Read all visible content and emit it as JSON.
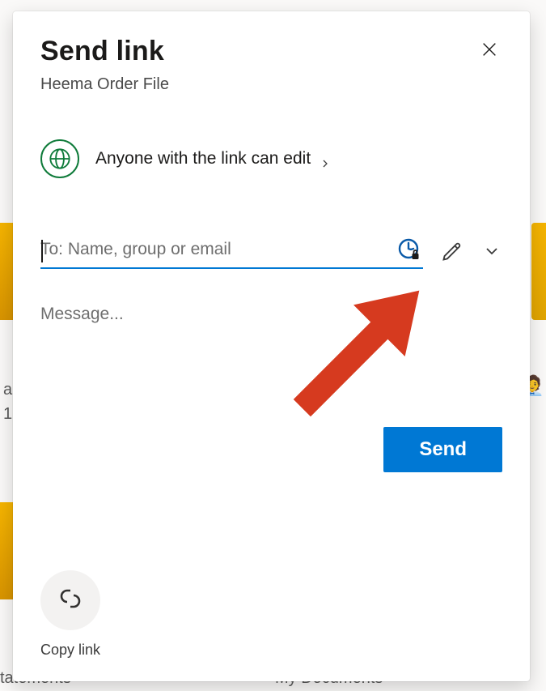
{
  "dialog": {
    "title": "Send link",
    "subtitle": "Heema Order File",
    "permission_text": "Anyone with the link can edit",
    "recipient_placeholder": "To: Name, group or email",
    "message_placeholder": "Message...",
    "send_label": "Send",
    "copy_link_label": "Copy link"
  },
  "background": {
    "text_left": "tatements",
    "text_right": "My Documents",
    "row_a": "a",
    "row_1": "1"
  }
}
